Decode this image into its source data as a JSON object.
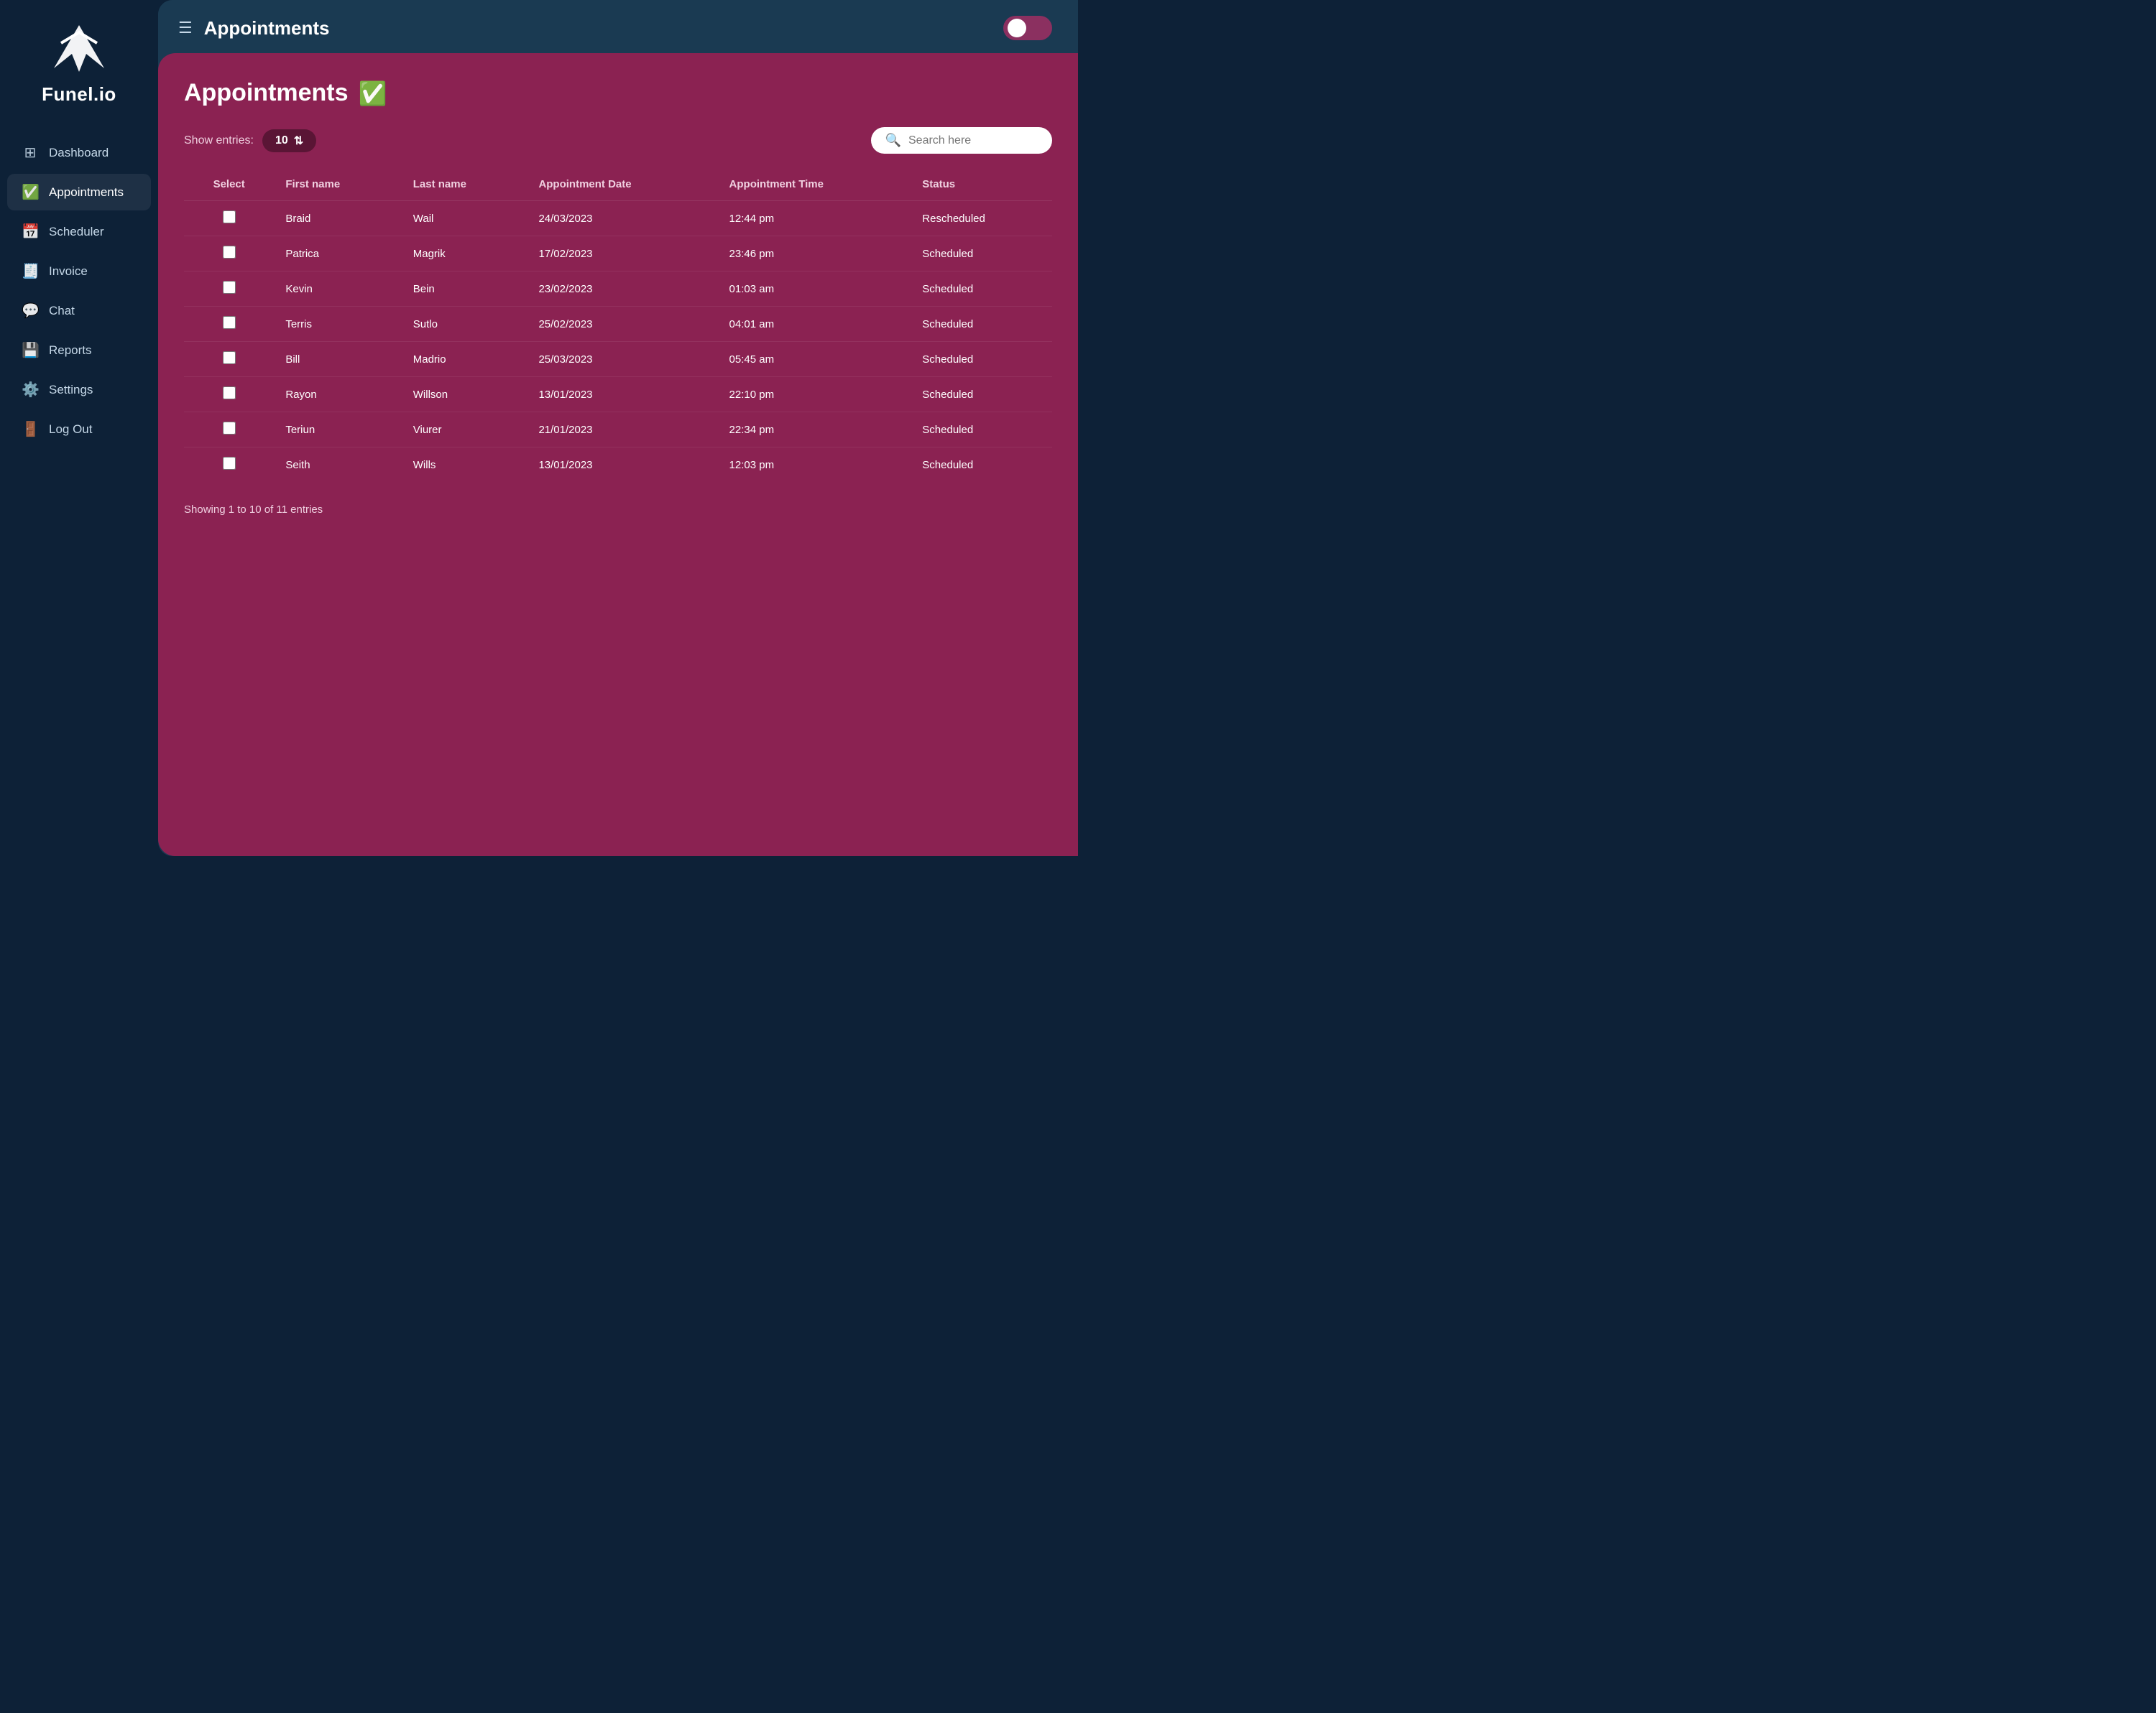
{
  "app": {
    "name": "Funel.io"
  },
  "sidebar": {
    "items": [
      {
        "id": "dashboard",
        "label": "Dashboard",
        "icon": "⊞",
        "active": false
      },
      {
        "id": "appointments",
        "label": "Appointments",
        "icon": "✅",
        "active": true
      },
      {
        "id": "scheduler",
        "label": "Scheduler",
        "icon": "📅",
        "active": false
      },
      {
        "id": "invoice",
        "label": "Invoice",
        "icon": "🧾",
        "active": false
      },
      {
        "id": "chat",
        "label": "Chat",
        "icon": "💬",
        "active": false
      },
      {
        "id": "reports",
        "label": "Reports",
        "icon": "💾",
        "active": false
      },
      {
        "id": "settings",
        "label": "Settings",
        "icon": "⚙️",
        "active": false
      },
      {
        "id": "logout",
        "label": "Log Out",
        "icon": "🚪",
        "active": false
      }
    ]
  },
  "topbar": {
    "title": "Appointments",
    "toggle_state": true
  },
  "content": {
    "title": "Appointments",
    "show_entries_label": "Show entries:",
    "entries_count": "10",
    "search_placeholder": "Search here",
    "table": {
      "columns": [
        "Select",
        "First name",
        "Last name",
        "Appointment Date",
        "Appointment Time",
        "Status"
      ],
      "rows": [
        {
          "first_name": "Braid",
          "last_name": "Wail",
          "date": "24/03/2023",
          "time": "12:44 pm",
          "status": "Rescheduled"
        },
        {
          "first_name": "Patrica",
          "last_name": "Magrik",
          "date": "17/02/2023",
          "time": "23:46 pm",
          "status": "Scheduled"
        },
        {
          "first_name": "Kevin",
          "last_name": "Bein",
          "date": "23/02/2023",
          "time": "01:03 am",
          "status": "Scheduled"
        },
        {
          "first_name": "Terris",
          "last_name": "Sutlo",
          "date": "25/02/2023",
          "time": "04:01 am",
          "status": "Scheduled"
        },
        {
          "first_name": "Bill",
          "last_name": "Madrio",
          "date": "25/03/2023",
          "time": "05:45 am",
          "status": "Scheduled"
        },
        {
          "first_name": "Rayon",
          "last_name": "Willson",
          "date": "13/01/2023",
          "time": "22:10 pm",
          "status": "Scheduled"
        },
        {
          "first_name": "Teriun",
          "last_name": "Viurer",
          "date": "21/01/2023",
          "time": "22:34 pm",
          "status": "Scheduled"
        },
        {
          "first_name": "Seith",
          "last_name": "Wills",
          "date": "13/01/2023",
          "time": "12:03 pm",
          "status": "Scheduled"
        }
      ]
    },
    "footer": "Showing 1 to 10 of 11 entries"
  }
}
